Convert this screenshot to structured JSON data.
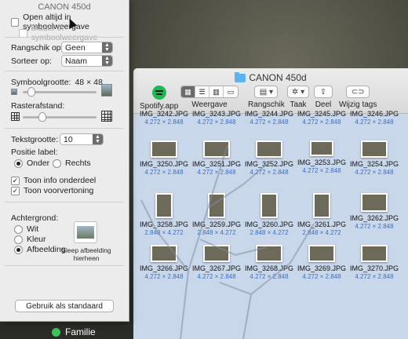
{
  "desktop": {
    "tag_label": "Familie"
  },
  "panel": {
    "title": "CANON 450d",
    "always_icon_view": "Open altijd in symboolweergave",
    "browse_icon_view": "Blader in symboolweergave",
    "arrange_label": "Rangschik op:",
    "arrange_value": "Geen",
    "sort_label": "Sorteer op:",
    "sort_value": "Naam",
    "icon_size_label": "Symboolgrootte:",
    "icon_size_value": "48 × 48",
    "icon_size_fraction": 0.12,
    "grid_spacing_label": "Rasterafstand:",
    "grid_spacing_fraction": 0.27,
    "text_size_label": "Tekstgrootte:",
    "text_size_value": "10",
    "label_position_label": "Positie label:",
    "label_bottom": "Onder",
    "label_right": "Rechts",
    "show_info": "Toon info onderdeel",
    "show_preview": "Toon voorvertoning",
    "background_label": "Achtergrond:",
    "bg_white": "Wit",
    "bg_color": "Kleur",
    "bg_picture": "Afbeelding",
    "drop_hint": "Sleep afbeelding hierheen",
    "use_default": "Gebruik als standaard"
  },
  "finder": {
    "title": "CANON 450d",
    "toolbar": {
      "spotify": "Spotify.app",
      "view": "Weergave",
      "arrange": "Rangschik",
      "action": "Taak",
      "share": "Deel",
      "tags": "Wijzig tags"
    },
    "rows": [
      [
        {
          "name": "IMG_3242.JPG",
          "size": "4.272 × 2.848"
        },
        {
          "name": "IMG_3243.JPG",
          "size": "4.272 × 2.848"
        },
        {
          "name": "IMG_3244.JPG",
          "size": "4.272 × 2.848"
        },
        {
          "name": "IMG_3245.JPG",
          "size": "4.272 × 2.848"
        },
        {
          "name": "IMG_3246.JPG",
          "size": "4.272 × 2.848"
        }
      ],
      [
        {
          "name": "IMG_3250.JPG",
          "size": "4.272 × 2.848"
        },
        {
          "name": "IMG_3251.JPG",
          "size": "4.272 × 2.848"
        },
        {
          "name": "IMG_3252.JPG",
          "size": "4.272 × 2.848"
        },
        {
          "name": "IMG_3253.JPG",
          "size": "4.272 × 2.848"
        },
        {
          "name": "IMG_3254.JPG",
          "size": "4.272 × 2.848"
        }
      ],
      [
        {
          "name": "IMG_3258.JPG",
          "size": "2.848 × 4.272"
        },
        {
          "name": "IMG_3259.JPG",
          "size": "2.848 × 4.272"
        },
        {
          "name": "IMG_3260.JPG",
          "size": "2.848 × 4.272"
        },
        {
          "name": "IMG_3261.JPG",
          "size": "2.848 × 4.272"
        },
        {
          "name": "IMG_3262.JPG",
          "size": "4.272 × 2.848"
        }
      ],
      [
        {
          "name": "IMG_3266.JPG",
          "size": "4.272 × 2.848"
        },
        {
          "name": "IMG_3267.JPG",
          "size": "4.272 × 2.848"
        },
        {
          "name": "IMG_3268.JPG",
          "size": "4.272 × 2.848"
        },
        {
          "name": "IMG_3269.JPG",
          "size": "4.272 × 2.848"
        },
        {
          "name": "IMG_3270.JPG",
          "size": "4.272 × 2.848"
        }
      ]
    ]
  }
}
